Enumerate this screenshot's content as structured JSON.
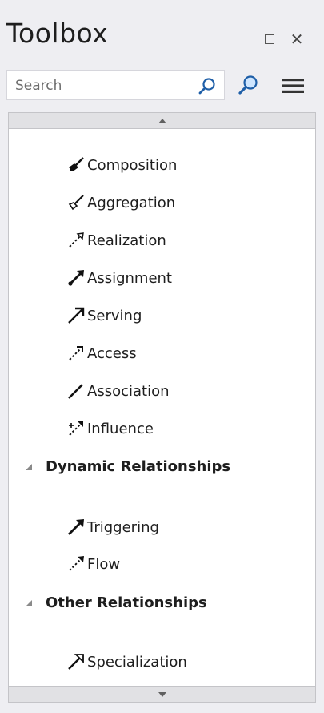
{
  "panel": {
    "title": "Toolbox"
  },
  "search": {
    "placeholder": "Search"
  },
  "relationships": [
    {
      "label": "Composition",
      "icon": "composition-icon"
    },
    {
      "label": "Aggregation",
      "icon": "aggregation-icon"
    },
    {
      "label": "Realization",
      "icon": "realization-icon"
    },
    {
      "label": "Assignment",
      "icon": "assignment-icon"
    },
    {
      "label": "Serving",
      "icon": "serving-icon"
    },
    {
      "label": "Access",
      "icon": "access-icon"
    },
    {
      "label": "Association",
      "icon": "association-icon"
    },
    {
      "label": "Influence",
      "icon": "influence-icon"
    }
  ],
  "dynamic_group": {
    "label": "Dynamic Relationships",
    "items": [
      {
        "label": "Triggering",
        "icon": "triggering-icon"
      },
      {
        "label": "Flow",
        "icon": "flow-icon"
      }
    ]
  },
  "other_group": {
    "label": "Other Relationships",
    "items": [
      {
        "label": "Specialization",
        "icon": "specialization-icon"
      }
    ]
  }
}
